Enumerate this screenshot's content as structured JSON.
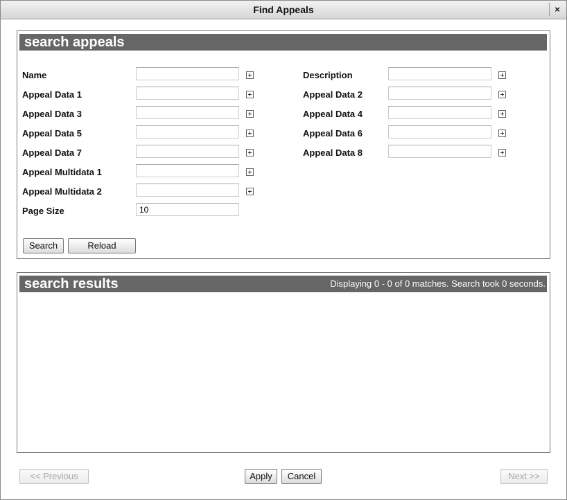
{
  "window": {
    "title": "Find Appeals",
    "close_label": "×"
  },
  "search_panel": {
    "title": "search appeals",
    "left_fields": [
      {
        "label": "Name",
        "value": ""
      },
      {
        "label": "Appeal Data 1",
        "value": ""
      },
      {
        "label": "Appeal Data 3",
        "value": ""
      },
      {
        "label": "Appeal Data 5",
        "value": ""
      },
      {
        "label": "Appeal Data 7",
        "value": ""
      },
      {
        "label": "Appeal Multidata 1",
        "value": ""
      },
      {
        "label": "Appeal Multidata 2",
        "value": ""
      },
      {
        "label": "Page Size",
        "value": "10"
      }
    ],
    "right_fields": [
      {
        "label": "Description",
        "value": ""
      },
      {
        "label": "Appeal Data 2",
        "value": ""
      },
      {
        "label": "Appeal Data 4",
        "value": ""
      },
      {
        "label": "Appeal Data 6",
        "value": ""
      },
      {
        "label": "Appeal Data 8",
        "value": ""
      }
    ],
    "search_label": "Search",
    "reload_label": "Reload"
  },
  "results_panel": {
    "title": "search results",
    "status": "Displaying 0 - 0 of 0 matches. Search took 0 seconds."
  },
  "footer": {
    "previous_label": "<< Previous",
    "apply_label": "Apply",
    "cancel_label": "Cancel",
    "next_label": "Next >>"
  }
}
